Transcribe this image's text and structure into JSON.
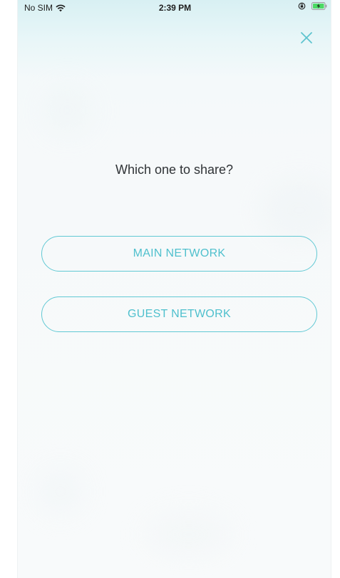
{
  "status_bar": {
    "carrier": "No SIM",
    "time": "2:39 PM",
    "wifi_icon": "wifi-icon",
    "orientation_lock_icon": "orientation-lock-icon",
    "battery_icon": "battery-charging-icon"
  },
  "header": {
    "close_icon": "close-icon"
  },
  "content": {
    "prompt": "Which one to share?",
    "options": [
      {
        "label": "MAIN NETWORK"
      },
      {
        "label": "GUEST NETWORK"
      }
    ]
  },
  "colors": {
    "accent": "#4fc0cd",
    "close_icon": "#5ec4cf",
    "text": "#2f3336"
  }
}
